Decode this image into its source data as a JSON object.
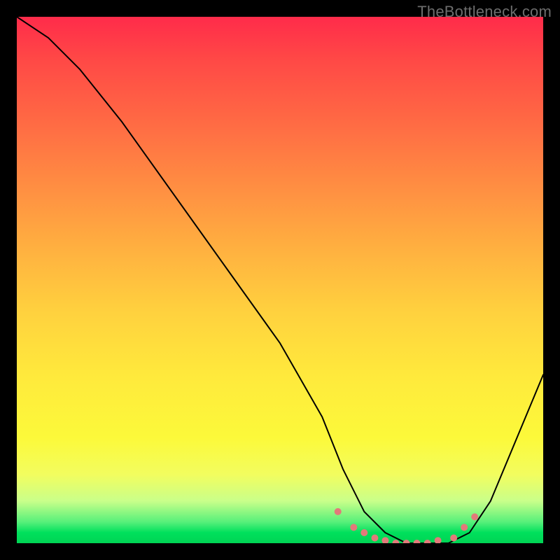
{
  "watermark": "TheBottleneck.com",
  "chart_data": {
    "type": "line",
    "title": "",
    "xlabel": "",
    "ylabel": "",
    "xlim": [
      0,
      100
    ],
    "ylim": [
      0,
      100
    ],
    "grid": false,
    "legend": false,
    "series": [
      {
        "name": "bottleneck-curve",
        "x": [
          0,
          6,
          12,
          20,
          30,
          40,
          50,
          58,
          62,
          66,
          70,
          74,
          78,
          82,
          86,
          90,
          100
        ],
        "values": [
          100,
          96,
          90,
          80,
          66,
          52,
          38,
          24,
          14,
          6,
          2,
          0,
          0,
          0,
          2,
          8,
          32
        ],
        "stroke": "#000000",
        "stroke_width": 2
      }
    ],
    "markers": {
      "name": "bottleneck-band",
      "color": "#e27a7a",
      "radius": 5,
      "x": [
        61,
        64,
        66,
        68,
        70,
        72,
        74,
        76,
        78,
        80,
        83,
        85,
        87
      ],
      "values": [
        6,
        3,
        2,
        1,
        0.5,
        0,
        0,
        0,
        0,
        0.5,
        1,
        3,
        5
      ]
    }
  }
}
